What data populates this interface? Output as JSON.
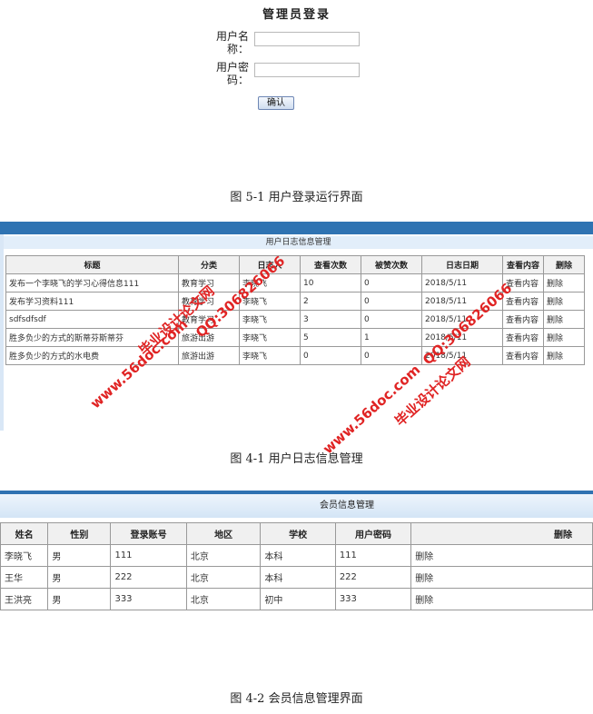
{
  "login": {
    "title": "管理员登录",
    "username_label_line1": "用户名",
    "username_label_line2": "称：",
    "password_label_line1": "用户密",
    "password_label_line2": "码：",
    "username_value": "",
    "password_value": "",
    "submit_label": "确认"
  },
  "captions": {
    "login": "图 5-1 用户登录运行界面",
    "logs": "图 4-1 用户日志信息管理",
    "members": "图 4-2 会员信息管理界面"
  },
  "logs_panel": {
    "title": "用户日志信息管理",
    "columns": [
      "标题",
      "分类",
      "日志人",
      "查看次数",
      "被赞次数",
      "日志日期",
      "查看内容",
      "删除"
    ],
    "rows": [
      {
        "title": "发布一个李晓飞的学习心得信息111",
        "category": "教育学习",
        "author": "李晓飞",
        "views": "10",
        "likes": "0",
        "date": "2018/5/11",
        "view_link": "查看内容",
        "delete_link": "删除"
      },
      {
        "title": "发布学习资料111",
        "category": "教育学习",
        "author": "李晓飞",
        "views": "2",
        "likes": "0",
        "date": "2018/5/11",
        "view_link": "查看内容",
        "delete_link": "删除"
      },
      {
        "title": "sdfsdfsdf",
        "category": "教育学习",
        "author": "李晓飞",
        "views": "3",
        "likes": "0",
        "date": "2018/5/11",
        "view_link": "查看内容",
        "delete_link": "删除"
      },
      {
        "title": "胜多负少的方式的斯蒂芬斯蒂芬",
        "category": "旅游出游",
        "author": "李晓飞",
        "views": "5",
        "likes": "1",
        "date": "2018/5/11",
        "view_link": "查看内容",
        "delete_link": "删除"
      },
      {
        "title": "胜多负少的方式的水电费",
        "category": "旅游出游",
        "author": "李晓飞",
        "views": "0",
        "likes": "0",
        "date": "2018/5/11",
        "view_link": "查看内容",
        "delete_link": "删除"
      }
    ]
  },
  "members_panel": {
    "title": "会员信息管理",
    "columns": [
      "姓名",
      "性别",
      "登录账号",
      "地区",
      "学校",
      "用户密码",
      "删除"
    ],
    "rows": [
      {
        "name": "李晓飞",
        "gender": "男",
        "account": "111",
        "region": "北京",
        "school": "本科",
        "password": "111",
        "delete_link": "删除"
      },
      {
        "name": "王华",
        "gender": "男",
        "account": "222",
        "region": "北京",
        "school": "本科",
        "password": "222",
        "delete_link": "删除"
      },
      {
        "name": "王洪亮",
        "gender": "男",
        "account": "333",
        "region": "北京",
        "school": "初中",
        "password": "333",
        "delete_link": "删除"
      }
    ]
  },
  "watermark": {
    "site_name": "毕业设计论文网",
    "url": "www.56doc.com",
    "qq": "QQ:306826066"
  },
  "colors": {
    "header_bar": "#2f73b2",
    "link": "#3a67c8",
    "watermark": "#e02424"
  }
}
